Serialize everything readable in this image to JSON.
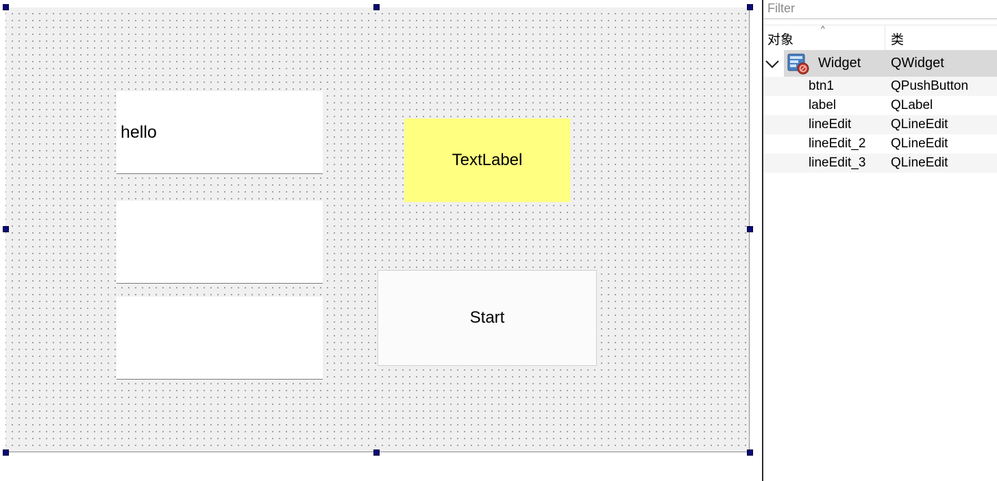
{
  "form": {
    "line_edits": [
      {
        "name": "lineEdit",
        "value": "hello"
      },
      {
        "name": "lineEdit_2",
        "value": ""
      },
      {
        "name": "lineEdit_3",
        "value": ""
      }
    ],
    "label": {
      "text": "TextLabel",
      "background": "#ffff80"
    },
    "button": {
      "text": "Start"
    }
  },
  "inspector": {
    "filter_placeholder": "Filter",
    "columns": {
      "object": "对象",
      "class": "类"
    },
    "root": {
      "name": "Widget",
      "class": "QWidget",
      "icon": "widget-icon"
    },
    "children": [
      {
        "name": "btn1",
        "class": "QPushButton"
      },
      {
        "name": "label",
        "class": "QLabel"
      },
      {
        "name": "lineEdit",
        "class": "QLineEdit"
      },
      {
        "name": "lineEdit_2",
        "class": "QLineEdit"
      },
      {
        "name": "lineEdit_3",
        "class": "QLineEdit"
      }
    ]
  },
  "colors": {
    "selection_handle": "#0a0a78",
    "canvas_bg": "#f0f0f0",
    "tree_selection": "#d9d9d9"
  }
}
